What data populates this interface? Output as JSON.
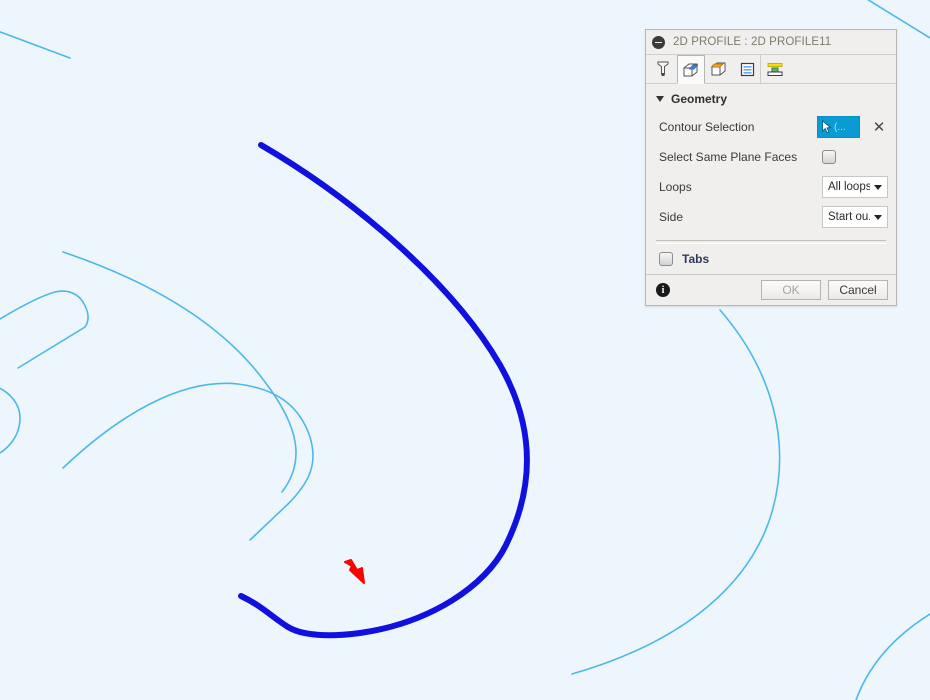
{
  "viewport": {
    "background_color": "#eef6fd",
    "sketch_curve_color": "#4cb8e8",
    "selected_contour_color": "#1010e0",
    "marker_color": "#ff0000",
    "marker_name": "red-arrow-annotation"
  },
  "panel": {
    "title": "2D PROFILE : 2D PROFILE11",
    "collapse_icon": "collapse-minus-icon",
    "tabs": [
      {
        "name": "tool-tab",
        "icon": "end-mill-tool-icon",
        "active": false
      },
      {
        "name": "geometry-tab",
        "icon": "geometry-box-icon",
        "active": true
      },
      {
        "name": "heights-tab",
        "icon": "heights-box-icon",
        "active": false
      },
      {
        "name": "passes-tab",
        "icon": "passes-layers-icon",
        "active": false
      },
      {
        "name": "linking-tab",
        "icon": "linking-ramp-icon",
        "active": false
      }
    ],
    "geometry": {
      "section_label": "Geometry",
      "expanded": true,
      "contour_selection": {
        "label": "Contour Selection",
        "button_icon": "mouse-cursor-select-icon",
        "button_text": "(...",
        "button_active": true,
        "clear_icon": "✕"
      },
      "select_same_plane_faces": {
        "label": "Select Same Plane Faces",
        "checked": false
      },
      "loops": {
        "label": "Loops",
        "value": "All loops",
        "options": [
          "All loops"
        ]
      },
      "side": {
        "label": "Side",
        "value": "Start ou...",
        "options": [
          "Start ou..."
        ]
      }
    },
    "tabs_section": {
      "label": "Tabs",
      "checked": false
    },
    "footer": {
      "info_icon": "info-icon",
      "info_glyph": "i",
      "ok_label": "OK",
      "ok_enabled": false,
      "cancel_label": "Cancel"
    }
  }
}
